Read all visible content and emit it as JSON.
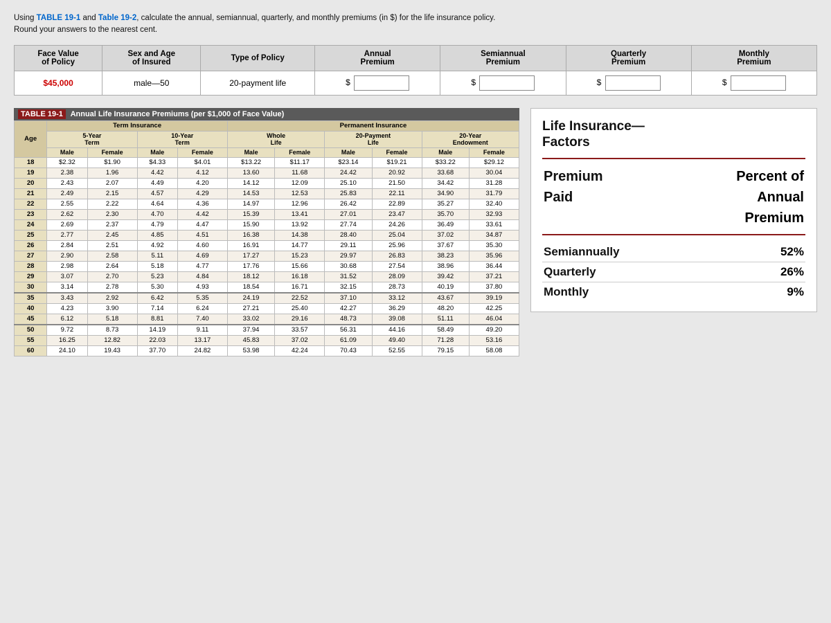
{
  "intro": {
    "line1": "Using ",
    "table191": "Table 19-1",
    "and": " and ",
    "table192": "Table 19-2",
    "line1end": ", calculate the annual, semiannual, quarterly, and monthly premiums (in $) for the life insurance policy.",
    "line2": "Round your answers to the nearest cent."
  },
  "top_table": {
    "headers": [
      "Face Value\nof Policy",
      "Sex and Age\nof Insured",
      "Type of Policy",
      "Annual\nPremium",
      "Semiannual\nPremium",
      "Quarterly\nPremium",
      "Monthly\nPremium"
    ],
    "row": {
      "face_value": "$45,000",
      "insured": "male—50",
      "policy_type": "20-payment life"
    }
  },
  "ins_table": {
    "title_tag": "TABLE 19-1",
    "title_text": "Annual Life Insurance Premiums (per $1,000 of Face Value)",
    "headers": {
      "term_insurance": "Term Insurance",
      "permanent_insurance": "Permanent Insurance"
    },
    "sub_headers": {
      "five_year": "5-Year\nTerm",
      "ten_year": "10-Year\nTerm",
      "whole_life": "Whole\nLife",
      "twenty_payment": "20-Payment\nLife",
      "twenty_year_endow": "20-Year\nEndowment"
    },
    "col_headers": [
      "Age",
      "Male",
      "Female",
      "Male",
      "Female",
      "Male",
      "Female",
      "Male",
      "Female",
      "Male",
      "Female"
    ],
    "rows": [
      [
        "18",
        "$2.32",
        "$1.90",
        "$4.33",
        "$4.01",
        "$13.22",
        "$11.17",
        "$23.14",
        "$19.21",
        "$33.22",
        "$29.12"
      ],
      [
        "19",
        "2.38",
        "1.96",
        "4.42",
        "4.12",
        "13.60",
        "11.68",
        "24.42",
        "20.92",
        "33.68",
        "30.04"
      ],
      [
        "20",
        "2.43",
        "2.07",
        "4.49",
        "4.20",
        "14.12",
        "12.09",
        "25.10",
        "21.50",
        "34.42",
        "31.28"
      ],
      [
        "21",
        "2.49",
        "2.15",
        "4.57",
        "4.29",
        "14.53",
        "12.53",
        "25.83",
        "22.11",
        "34.90",
        "31.79"
      ],
      [
        "22",
        "2.55",
        "2.22",
        "4.64",
        "4.36",
        "14.97",
        "12.96",
        "26.42",
        "22.89",
        "35.27",
        "32.40"
      ],
      [
        "23",
        "2.62",
        "2.30",
        "4.70",
        "4.42",
        "15.39",
        "13.41",
        "27.01",
        "23.47",
        "35.70",
        "32.93"
      ],
      [
        "24",
        "2.69",
        "2.37",
        "4.79",
        "4.47",
        "15.90",
        "13.92",
        "27.74",
        "24.26",
        "36.49",
        "33.61"
      ],
      [
        "25",
        "2.77",
        "2.45",
        "4.85",
        "4.51",
        "16.38",
        "14.38",
        "28.40",
        "25.04",
        "37.02",
        "34.87"
      ],
      [
        "26",
        "2.84",
        "2.51",
        "4.92",
        "4.60",
        "16.91",
        "14.77",
        "29.11",
        "25.96",
        "37.67",
        "35.30"
      ],
      [
        "27",
        "2.90",
        "2.58",
        "5.11",
        "4.69",
        "17.27",
        "15.23",
        "29.97",
        "26.83",
        "38.23",
        "35.96"
      ],
      [
        "28",
        "2.98",
        "2.64",
        "5.18",
        "4.77",
        "17.76",
        "15.66",
        "30.68",
        "27.54",
        "38.96",
        "36.44"
      ],
      [
        "29",
        "3.07",
        "2.70",
        "5.23",
        "4.84",
        "18.12",
        "16.18",
        "31.52",
        "28.09",
        "39.42",
        "37.21"
      ],
      [
        "30",
        "3.14",
        "2.78",
        "5.30",
        "4.93",
        "18.54",
        "16.71",
        "32.15",
        "28.73",
        "40.19",
        "37.80"
      ],
      [
        "35",
        "3.43",
        "2.92",
        "6.42",
        "5.35",
        "24.19",
        "22.52",
        "37.10",
        "33.12",
        "43.67",
        "39.19"
      ],
      [
        "40",
        "4.23",
        "3.90",
        "7.14",
        "6.24",
        "27.21",
        "25.40",
        "42.27",
        "36.29",
        "48.20",
        "42.25"
      ],
      [
        "45",
        "6.12",
        "5.18",
        "8.81",
        "7.40",
        "33.02",
        "29.16",
        "48.73",
        "39.08",
        "51.11",
        "46.04"
      ],
      [
        "50",
        "9.72",
        "8.73",
        "14.19",
        "9.11",
        "37.94",
        "33.57",
        "56.31",
        "44.16",
        "58.49",
        "49.20"
      ],
      [
        "55",
        "16.25",
        "12.82",
        "22.03",
        "13.17",
        "45.83",
        "37.02",
        "61.09",
        "49.40",
        "71.28",
        "53.16"
      ],
      [
        "60",
        "24.10",
        "19.43",
        "37.70",
        "24.82",
        "53.98",
        "42.24",
        "70.43",
        "52.55",
        "79.15",
        "58.08"
      ]
    ]
  },
  "right_panel": {
    "title_line1": "Life Insurance",
    "title_line2": "Factors",
    "divider": true,
    "premium_label": "Premium",
    "paid_label": "Paid",
    "percent_label": "Percent of",
    "annual_label": "Annual",
    "premium2_label": "Premium",
    "factors": [
      {
        "label": "Semiannually",
        "value": "52%"
      },
      {
        "label": "Quarterly",
        "value": "26%"
      },
      {
        "label": "Monthly",
        "value": "9%"
      }
    ]
  }
}
